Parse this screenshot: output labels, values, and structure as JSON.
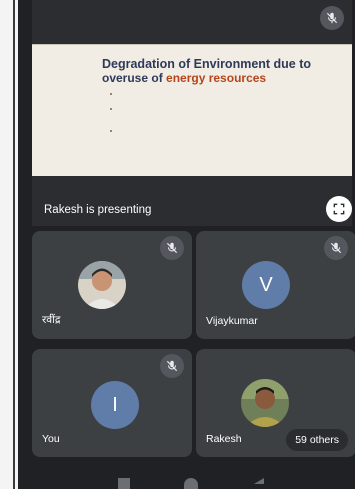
{
  "presentation": {
    "slide_title_line1": "Degradation of Environment due to",
    "slide_subtitle_prefix": "overuse of ",
    "slide_subtitle_highlight": "energy resources",
    "presenting_label": "Rakesh is presenting"
  },
  "participants": [
    {
      "name": "रवींद्र",
      "avatar_type": "photo",
      "muted": true
    },
    {
      "name": "Vijaykumar",
      "avatar_type": "letter",
      "avatar_letter": "V",
      "muted": true
    },
    {
      "name": "You",
      "avatar_type": "letter",
      "avatar_letter": "I",
      "muted": true
    },
    {
      "name": "Rakesh",
      "avatar_type": "photo",
      "muted": false
    }
  ],
  "others_chip": "59 others",
  "icons": {
    "mic_off": "mic-off-icon",
    "fullscreen": "fullscreen-icon",
    "nav_recent": "recents-icon",
    "nav_home": "home-icon",
    "nav_back": "back-icon"
  },
  "colors": {
    "background": "#1f2125",
    "tile": "#3c4043",
    "avatar_letter_bg": "#5f7da8",
    "slide_title": "#2e3a59",
    "slide_highlight": "#b5451b"
  }
}
